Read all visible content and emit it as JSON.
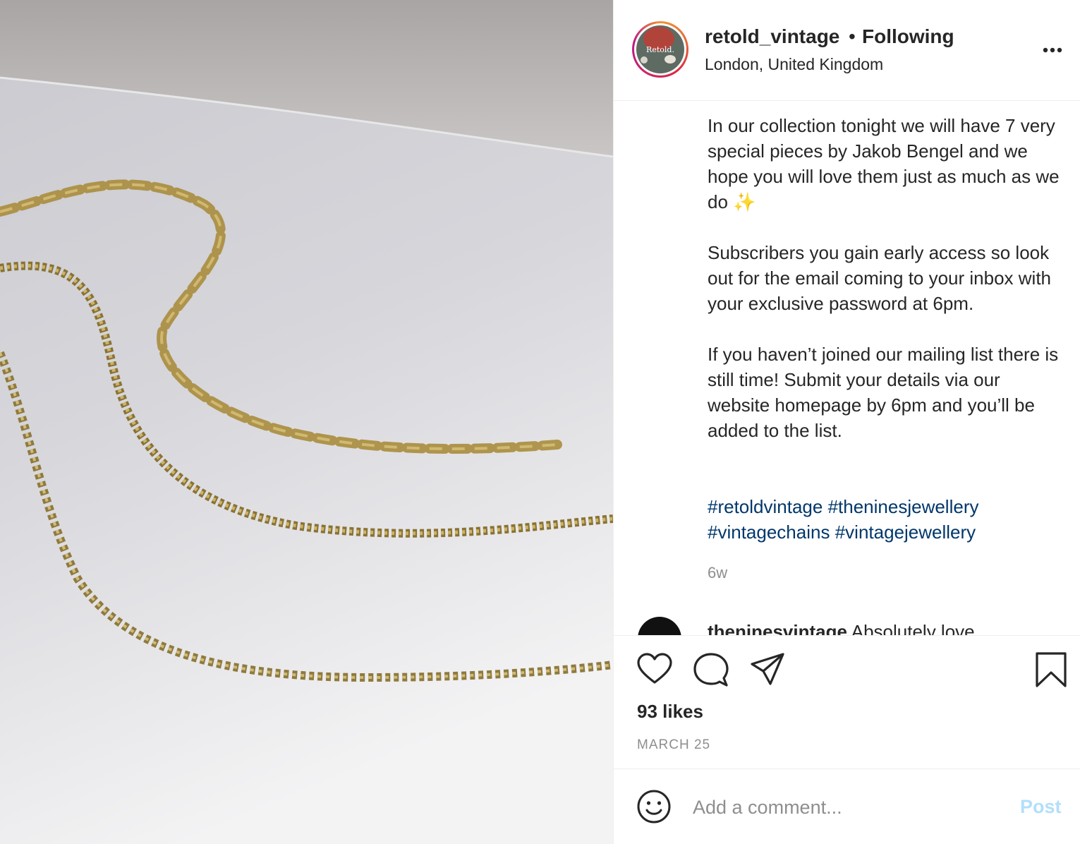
{
  "post_image": {
    "alt": ""
  },
  "header": {
    "username": "retold_vintage",
    "separator": "•",
    "follow_status": "Following",
    "location": "London, United Kingdom",
    "avatar_text": "Retold."
  },
  "caption": {
    "paragraphs": [
      "In our collection tonight we will have 7 very special pieces by Jakob Bengel and we hope you will love them just as much as we do ✨",
      "Subscribers you gain early access so look out for the email coming to your inbox with your exclusive password at 6pm.",
      "If you haven’t joined our mailing list there is still time! Submit your details via our website homepage by 6pm and you’ll be added to the list."
    ],
    "hashtags": [
      "#retoldvintage",
      "#theninesjewellery",
      "#vintagechains",
      "#vintagejewellery"
    ],
    "time_ago": "6w"
  },
  "comment_preview": {
    "username": "theninesvintage",
    "text": "Absolutely love"
  },
  "actions": {
    "likes": "93 likes",
    "date": "MARCH 25"
  },
  "comment_box": {
    "placeholder": "Add a comment...",
    "post_label": "Post"
  },
  "colors": {
    "hashtag": "#00376b",
    "post_button_disabled": "#b2dffc",
    "muted_text": "#8e8e8e"
  }
}
